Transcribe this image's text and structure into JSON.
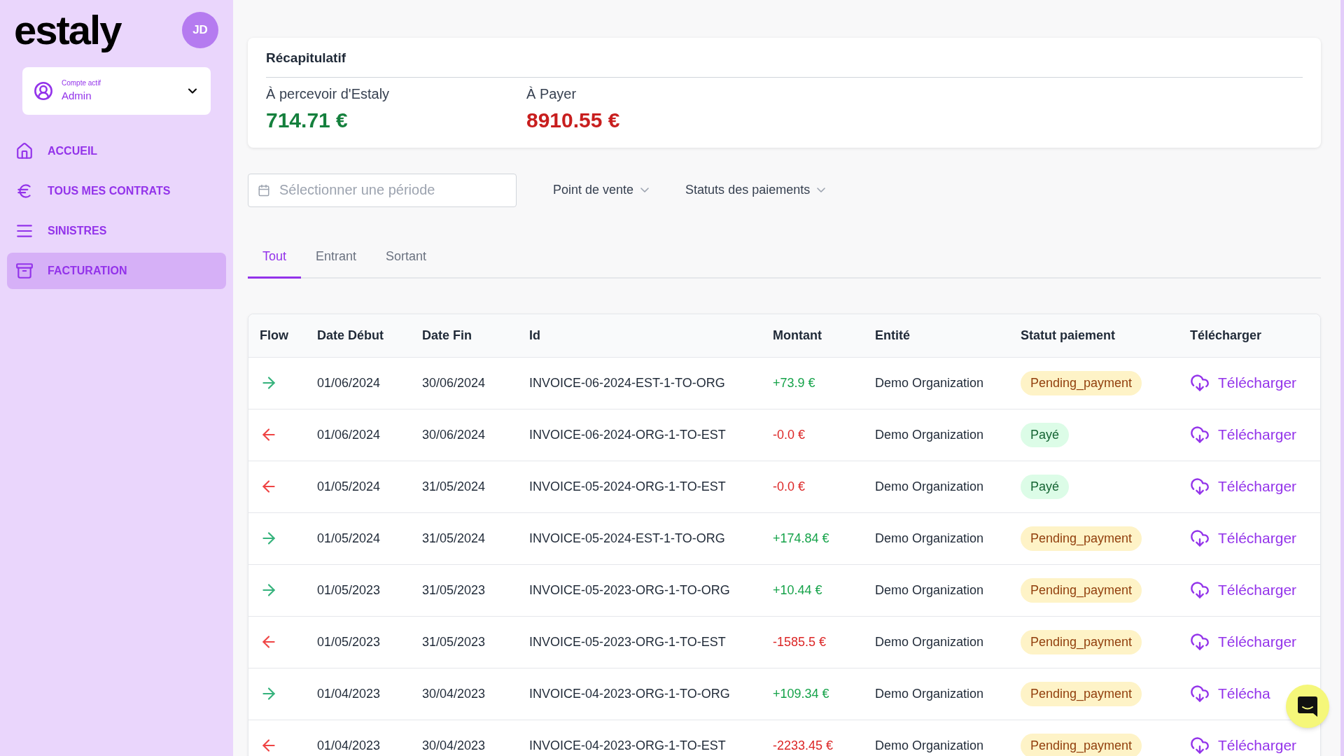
{
  "sidebar": {
    "logo": "estaly",
    "avatar": "JD",
    "account": {
      "caption": "Compte actif",
      "name": "Admin"
    },
    "items": [
      {
        "label": "ACCUEIL",
        "selected": false
      },
      {
        "label": "TOUS MES CONTRATS",
        "selected": false
      },
      {
        "label": "SINISTRES",
        "selected": false
      },
      {
        "label": "FACTURATION",
        "selected": true
      }
    ]
  },
  "summary": {
    "title": "Récapitulatif",
    "items": [
      {
        "label": "À percevoir d'Estaly",
        "value": "714.71 €",
        "kind": "in"
      },
      {
        "label": "À Payer",
        "value": "8910.55 €",
        "kind": "out"
      }
    ]
  },
  "filters": {
    "period": {
      "placeholder": "Sélectionner une période"
    },
    "dropdowns": [
      "Point de vente",
      "Statuts des paiements"
    ]
  },
  "tabs": [
    {
      "label": "Tout",
      "selected": true
    },
    {
      "label": "Entrant",
      "selected": false
    },
    {
      "label": "Sortant",
      "selected": false
    }
  ],
  "table": {
    "columns": [
      "Flow",
      "Date Début",
      "Date Fin",
      "Id",
      "Montant",
      "Entité",
      "Statut paiement",
      "Télécharger"
    ],
    "rows": [
      {
        "kind": "in",
        "start": "01/06/2024",
        "end": "30/06/2024",
        "id": "INVOICE-06-2024-EST-1-TO-ORG",
        "amount": "+73.9 €",
        "entity": "Demo Organization",
        "status": {
          "label": "Pending_payment",
          "kind": "pending"
        },
        "download": "Télécharger"
      },
      {
        "kind": "out",
        "start": "01/06/2024",
        "end": "30/06/2024",
        "id": "INVOICE-06-2024-ORG-1-TO-EST",
        "amount": "-0.0 €",
        "entity": "Demo Organization",
        "status": {
          "label": "Payé",
          "kind": "paid"
        },
        "download": "Télécharger"
      },
      {
        "kind": "out",
        "start": "01/05/2024",
        "end": "31/05/2024",
        "id": "INVOICE-05-2024-ORG-1-TO-EST",
        "amount": "-0.0 €",
        "entity": "Demo Organization",
        "status": {
          "label": "Payé",
          "kind": "paid"
        },
        "download": "Télécharger"
      },
      {
        "kind": "in",
        "start": "01/05/2024",
        "end": "31/05/2024",
        "id": "INVOICE-05-2024-EST-1-TO-ORG",
        "amount": "+174.84 €",
        "entity": "Demo Organization",
        "status": {
          "label": "Pending_payment",
          "kind": "pending"
        },
        "download": "Télécharger"
      },
      {
        "kind": "in",
        "start": "01/05/2023",
        "end": "31/05/2023",
        "id": "INVOICE-05-2023-ORG-1-TO-ORG",
        "amount": "+10.44 €",
        "entity": "Demo Organization",
        "status": {
          "label": "Pending_payment",
          "kind": "pending"
        },
        "download": "Télécharger"
      },
      {
        "kind": "out",
        "start": "01/05/2023",
        "end": "31/05/2023",
        "id": "INVOICE-05-2023-ORG-1-TO-EST",
        "amount": "-1585.5 €",
        "entity": "Demo Organization",
        "status": {
          "label": "Pending_payment",
          "kind": "pending"
        },
        "download": "Télécharger"
      },
      {
        "kind": "in",
        "start": "01/04/2023",
        "end": "30/04/2023",
        "id": "INVOICE-04-2023-ORG-1-TO-ORG",
        "amount": "+109.34 €",
        "entity": "Demo Organization",
        "status": {
          "label": "Pending_payment",
          "kind": "pending"
        },
        "download": "Télécha"
      },
      {
        "kind": "out",
        "start": "01/04/2023",
        "end": "30/04/2023",
        "id": "INVOICE-04-2023-ORG-1-TO-EST",
        "amount": "-2233.45 €",
        "entity": "Demo Organization",
        "status": {
          "label": "Pending_payment",
          "kind": "pending"
        },
        "download": "Télécharger"
      }
    ]
  }
}
